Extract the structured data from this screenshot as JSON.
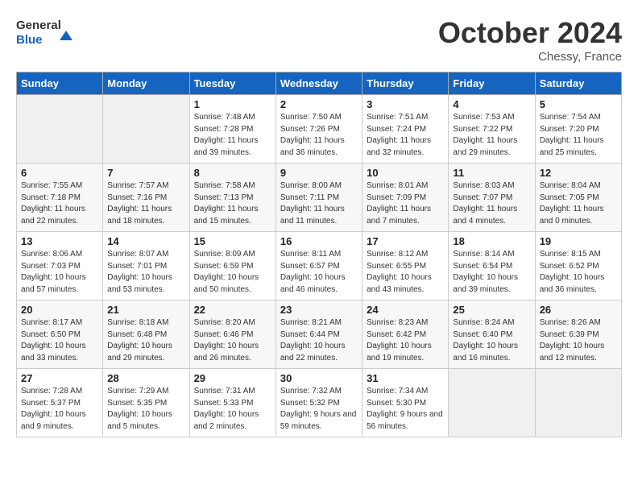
{
  "header": {
    "logo_line1": "General",
    "logo_line2": "Blue",
    "month_title": "October 2024",
    "location": "Chessy, France"
  },
  "weekdays": [
    "Sunday",
    "Monday",
    "Tuesday",
    "Wednesday",
    "Thursday",
    "Friday",
    "Saturday"
  ],
  "weeks": [
    [
      {
        "day": "",
        "empty": true
      },
      {
        "day": "",
        "empty": true
      },
      {
        "day": "1",
        "sunrise": "7:48 AM",
        "sunset": "7:28 PM",
        "daylight": "11 hours and 39 minutes."
      },
      {
        "day": "2",
        "sunrise": "7:50 AM",
        "sunset": "7:26 PM",
        "daylight": "11 hours and 36 minutes."
      },
      {
        "day": "3",
        "sunrise": "7:51 AM",
        "sunset": "7:24 PM",
        "daylight": "11 hours and 32 minutes."
      },
      {
        "day": "4",
        "sunrise": "7:53 AM",
        "sunset": "7:22 PM",
        "daylight": "11 hours and 29 minutes."
      },
      {
        "day": "5",
        "sunrise": "7:54 AM",
        "sunset": "7:20 PM",
        "daylight": "11 hours and 25 minutes."
      }
    ],
    [
      {
        "day": "6",
        "sunrise": "7:55 AM",
        "sunset": "7:18 PM",
        "daylight": "11 hours and 22 minutes."
      },
      {
        "day": "7",
        "sunrise": "7:57 AM",
        "sunset": "7:16 PM",
        "daylight": "11 hours and 18 minutes."
      },
      {
        "day": "8",
        "sunrise": "7:58 AM",
        "sunset": "7:13 PM",
        "daylight": "11 hours and 15 minutes."
      },
      {
        "day": "9",
        "sunrise": "8:00 AM",
        "sunset": "7:11 PM",
        "daylight": "11 hours and 11 minutes."
      },
      {
        "day": "10",
        "sunrise": "8:01 AM",
        "sunset": "7:09 PM",
        "daylight": "11 hours and 7 minutes."
      },
      {
        "day": "11",
        "sunrise": "8:03 AM",
        "sunset": "7:07 PM",
        "daylight": "11 hours and 4 minutes."
      },
      {
        "day": "12",
        "sunrise": "8:04 AM",
        "sunset": "7:05 PM",
        "daylight": "11 hours and 0 minutes."
      }
    ],
    [
      {
        "day": "13",
        "sunrise": "8:06 AM",
        "sunset": "7:03 PM",
        "daylight": "10 hours and 57 minutes."
      },
      {
        "day": "14",
        "sunrise": "8:07 AM",
        "sunset": "7:01 PM",
        "daylight": "10 hours and 53 minutes."
      },
      {
        "day": "15",
        "sunrise": "8:09 AM",
        "sunset": "6:59 PM",
        "daylight": "10 hours and 50 minutes."
      },
      {
        "day": "16",
        "sunrise": "8:11 AM",
        "sunset": "6:57 PM",
        "daylight": "10 hours and 46 minutes."
      },
      {
        "day": "17",
        "sunrise": "8:12 AM",
        "sunset": "6:55 PM",
        "daylight": "10 hours and 43 minutes."
      },
      {
        "day": "18",
        "sunrise": "8:14 AM",
        "sunset": "6:54 PM",
        "daylight": "10 hours and 39 minutes."
      },
      {
        "day": "19",
        "sunrise": "8:15 AM",
        "sunset": "6:52 PM",
        "daylight": "10 hours and 36 minutes."
      }
    ],
    [
      {
        "day": "20",
        "sunrise": "8:17 AM",
        "sunset": "6:50 PM",
        "daylight": "10 hours and 33 minutes."
      },
      {
        "day": "21",
        "sunrise": "8:18 AM",
        "sunset": "6:48 PM",
        "daylight": "10 hours and 29 minutes."
      },
      {
        "day": "22",
        "sunrise": "8:20 AM",
        "sunset": "6:46 PM",
        "daylight": "10 hours and 26 minutes."
      },
      {
        "day": "23",
        "sunrise": "8:21 AM",
        "sunset": "6:44 PM",
        "daylight": "10 hours and 22 minutes."
      },
      {
        "day": "24",
        "sunrise": "8:23 AM",
        "sunset": "6:42 PM",
        "daylight": "10 hours and 19 minutes."
      },
      {
        "day": "25",
        "sunrise": "8:24 AM",
        "sunset": "6:40 PM",
        "daylight": "10 hours and 16 minutes."
      },
      {
        "day": "26",
        "sunrise": "8:26 AM",
        "sunset": "6:39 PM",
        "daylight": "10 hours and 12 minutes."
      }
    ],
    [
      {
        "day": "27",
        "sunrise": "7:28 AM",
        "sunset": "5:37 PM",
        "daylight": "10 hours and 9 minutes."
      },
      {
        "day": "28",
        "sunrise": "7:29 AM",
        "sunset": "5:35 PM",
        "daylight": "10 hours and 5 minutes."
      },
      {
        "day": "29",
        "sunrise": "7:31 AM",
        "sunset": "5:33 PM",
        "daylight": "10 hours and 2 minutes."
      },
      {
        "day": "30",
        "sunrise": "7:32 AM",
        "sunset": "5:32 PM",
        "daylight": "9 hours and 59 minutes."
      },
      {
        "day": "31",
        "sunrise": "7:34 AM",
        "sunset": "5:30 PM",
        "daylight": "9 hours and 56 minutes."
      },
      {
        "day": "",
        "empty": true
      },
      {
        "day": "",
        "empty": true
      }
    ]
  ]
}
